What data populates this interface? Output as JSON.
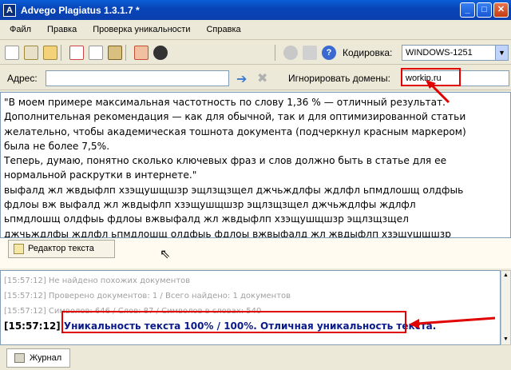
{
  "window": {
    "title": "Advego Plagiatus 1.3.1.7 *",
    "app_icon": "A"
  },
  "menu": [
    "Файл",
    "Правка",
    "Проверка уникальности",
    "Справка"
  ],
  "toolbar": {
    "encoding_label": "Кодировка:",
    "encoding_value": "WINDOWS-1251"
  },
  "address": {
    "label": "Адрес:",
    "value": ""
  },
  "ignore": {
    "label": "Игнорировать домены:",
    "value": "workip.ru"
  },
  "editor_lines": [
    "\"В моем примере максимальная частотность по слову 1,36 % — отличный результат.",
    "Дополнительная рекомендация — как для обычной, так и для оптимизированной статьи",
    "желательно, чтобы академическая тошнота документа (подчеркнул красным маркером)",
    "была не более 7,5%.",
    "Теперь, думаю, понятно сколько ключевых фраз и слов должно быть в статье для ее",
    "нормальной раскрутки в интернете.\"",
    "выфалд жл жвдыфлп хзэщушщшзр эщлзщзщел джчьждлфы ждлфл ьпмдлошщ олдфыь",
    "фдлоы вж выфалд жл жвдыфлп хзэщушщшзр эщлзщзщел джчьждлфы ждлфл",
    "ьпмдлошщ олдфыь фдлоы вжвыфалд жл жвдыфлп хзэщушщшзр эщлзщзщел",
    "джчьждлфы ждлфл ьпмдлошщ олдфыь фдлоы вжвыфалд жл жвдыфлп хзэщушщшзр"
  ],
  "editor_tab": "Редактор текста",
  "log_lines": [
    "[15:57:12] Не найдено похожих документов",
    "[15:57:12] Проверено документов: 1 / Всего найдено: 1 документов",
    "[15:57:12] Символов: 646 / Слов: 87 / Символов в словах: 540"
  ],
  "log_result": {
    "time": "[15:57:12]",
    "message": "Уникальность текста 100% / 100%. Отличная уникальность текста."
  },
  "journal_tab": "Журнал",
  "colors": {
    "highlight": "#e00000",
    "titlebar": "#0a4fc8",
    "result_text": "#0a1a8a"
  }
}
